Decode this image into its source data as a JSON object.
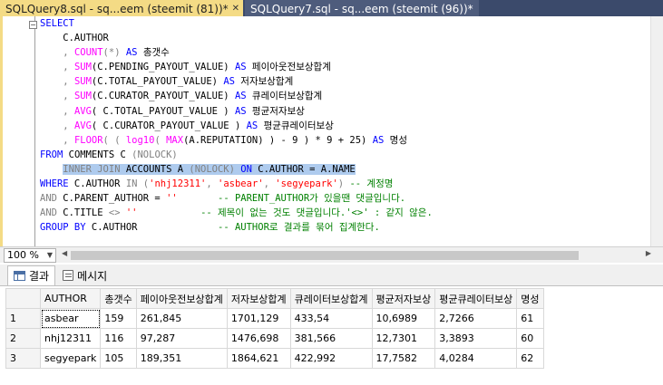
{
  "tabs": [
    {
      "label": "SQLQuery8.sql - sq...eem (steemit (81))*",
      "active": true,
      "icon": "pin-icon"
    },
    {
      "label": "SQLQuery7.sql - sq...eem (steemit (96))*",
      "active": false,
      "icon": "close-icon"
    }
  ],
  "editor": {
    "collapse_glyph": "−",
    "lines": {
      "l1": "SELECT",
      "l2": "    C.AUTHOR",
      "l3a": "    , ",
      "l3b": "COUNT",
      "l3c": "(*) ",
      "l3d": "AS",
      "l3e": " 총갯수",
      "l4a": "    , ",
      "l4b": "SUM",
      "l4c": "(C.PENDING_PAYOUT_VALUE) ",
      "l4d": "AS",
      "l4e": " 페이아웃전보상합계",
      "l5a": "    , ",
      "l5b": "SUM",
      "l5c": "(C.TOTAL_PAYOUT_VALUE) ",
      "l5d": "AS",
      "l5e": " 저자보상합계",
      "l6a": "    , ",
      "l6b": "SUM",
      "l6c": "(C.CURATOR_PAYOUT_VALUE) ",
      "l6d": "AS",
      "l6e": " 큐레이터보상합계",
      "l7a": "    , ",
      "l7b": "AVG",
      "l7c": "( C.TOTAL_PAYOUT_VALUE ) ",
      "l7d": "AS",
      "l7e": " 평균저자보상",
      "l8a": "    , ",
      "l8b": "AVG",
      "l8c": "( C.CURATOR_PAYOUT_VALUE ) ",
      "l8d": "AS",
      "l8e": " 평균큐레이터보상",
      "l9a": "    , ",
      "l9b": "FLOOR",
      "l9c": "( ( ",
      "l9d": "log10",
      "l9e": "( ",
      "l9f": "MAX",
      "l9g": "(A.REPUTATION) ) - 9 ) * 9 + 25) ",
      "l9h": "AS",
      "l9i": " 명성",
      "l10a": "FROM",
      "l10b": " COMMENTS C ",
      "l10c": "(NOLOCK)",
      "l11a": "    ",
      "l11b": "INNER JOIN",
      "l11c": " ACCOUNTS A ",
      "l11d": "(NOLOCK)",
      "l11e": " ON",
      "l11f": " C.AUTHOR = A.NAME",
      "l12a": "WHERE",
      "l12b": " C.AUTHOR ",
      "l12c": "IN",
      "l12d": " (",
      "l12e": "'nhj12311'",
      "l12f": ", ",
      "l12g": "'asbear'",
      "l12h": ", ",
      "l12i": "'segyepark'",
      "l12j": ") ",
      "l12k": "-- 계정명",
      "l13a": "AND",
      "l13b": " C.PARENT_AUTHOR = ",
      "l13c": "''",
      "l13d": "       ",
      "l13e": "-- PARENT_AUTHOR가 있을땐 댓글입니다.",
      "l14a": "AND",
      "l14b": " C.TITLE ",
      "l14c": "<>",
      "l14d": " ",
      "l14e": "''",
      "l14f": "           ",
      "l14g": "-- 제목이 없는 것도 댓글입니다.'<>' : 같지 않은.",
      "l15a": "GROUP BY",
      "l15b": " C.AUTHOR",
      "l15c": "              ",
      "l15d": "-- AUTHOR로 결과를 묶어 집계한다."
    }
  },
  "zoom": {
    "value": "100 %"
  },
  "results_tabs": [
    {
      "label": "결과",
      "icon": "grid-icon",
      "active": true
    },
    {
      "label": "메시지",
      "icon": "message-icon",
      "active": false
    }
  ],
  "grid": {
    "headers": [
      "AUTHOR",
      "총갯수",
      "페이아웃전보상합계",
      "저자보상합계",
      "큐레이터보상합계",
      "평균저자보상",
      "평균큐레이터보상",
      "명성"
    ],
    "rows": [
      {
        "n": "1",
        "cells": [
          "asbear",
          "159",
          "261,845",
          "1701,129",
          "433,54",
          "10,6989",
          "2,7266",
          "61"
        ]
      },
      {
        "n": "2",
        "cells": [
          "nhj12311",
          "116",
          "97,287",
          "1476,698",
          "381,566",
          "12,7301",
          "3,3893",
          "60"
        ]
      },
      {
        "n": "3",
        "cells": [
          "segyepark",
          "105",
          "189,351",
          "1864,621",
          "422,992",
          "17,7582",
          "4,0284",
          "62"
        ]
      }
    ]
  },
  "colors": {
    "tab_active": "#f4db85",
    "tab_strip": "#3b4a6b",
    "selection": "#aecbee",
    "keyword": "#0000ff",
    "function": "#ff00ff",
    "string": "#ff0000",
    "comment": "#008000"
  }
}
